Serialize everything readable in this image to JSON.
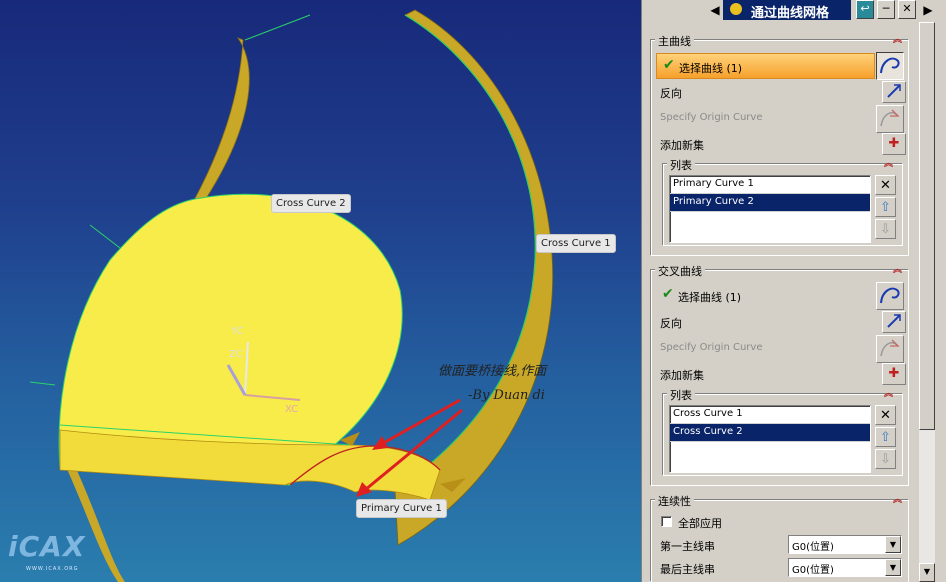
{
  "dialog": {
    "title": "通过曲线网格",
    "scroll_down_arrow": "▼"
  },
  "primary_curves": {
    "section_title": "主曲线",
    "select_label": "选择曲线 (1)",
    "reverse_label": "反向",
    "origin_label": "Specify Origin Curve",
    "add_set_label": "添加新集",
    "list_title": "列表",
    "items": [
      "Primary Curve  1",
      "Primary Curve  2"
    ],
    "selected_index": 1
  },
  "cross_curves": {
    "section_title": "交叉曲线",
    "select_label": "选择曲线 (1)",
    "reverse_label": "反向",
    "origin_label": "Specify Origin Curve",
    "add_set_label": "添加新集",
    "list_title": "列表",
    "items": [
      "Cross Curve  1",
      "Cross Curve  2"
    ],
    "selected_index": 1
  },
  "continuity": {
    "section_title": "连续性",
    "apply_all_label": "全部应用",
    "apply_all_checked": false,
    "first_primary_label": "第一主线串",
    "first_primary_value": "G0(位置)",
    "last_primary_label": "最后主线串",
    "last_primary_value": "G0(位置)"
  },
  "viewport": {
    "callouts": {
      "cross_curve_2": "Cross Curve  2",
      "cross_curve_1": "Cross Curve  1",
      "primary_curve_1": "Primary Curve  1"
    },
    "axes": {
      "x": "XC",
      "y": "YC",
      "z": "ZC"
    },
    "annotation_line1": "做面要桥接线,作面",
    "annotation_line2": "-By Duan di",
    "logo": "iCAX",
    "logo_url": "WWW.ICAX.ORG"
  },
  "colors": {
    "viewport_top": "#18297a",
    "viewport_bottom": "#2a7eae",
    "surface": "#f8ec4a",
    "ribbon": "#c9a727",
    "arrow": "#e02020",
    "highlight": "#f6a02b",
    "title_bar": "#0a246a"
  },
  "icons": [
    "dialog-menu-icon",
    "apply-icon",
    "minimize-icon",
    "close-icon",
    "scroll-left-icon",
    "scroll-right-icon",
    "select-curve-icon",
    "reverse-icon",
    "origin-curve-icon",
    "add-set-icon",
    "delete-icon",
    "move-up-icon",
    "move-down-icon"
  ]
}
